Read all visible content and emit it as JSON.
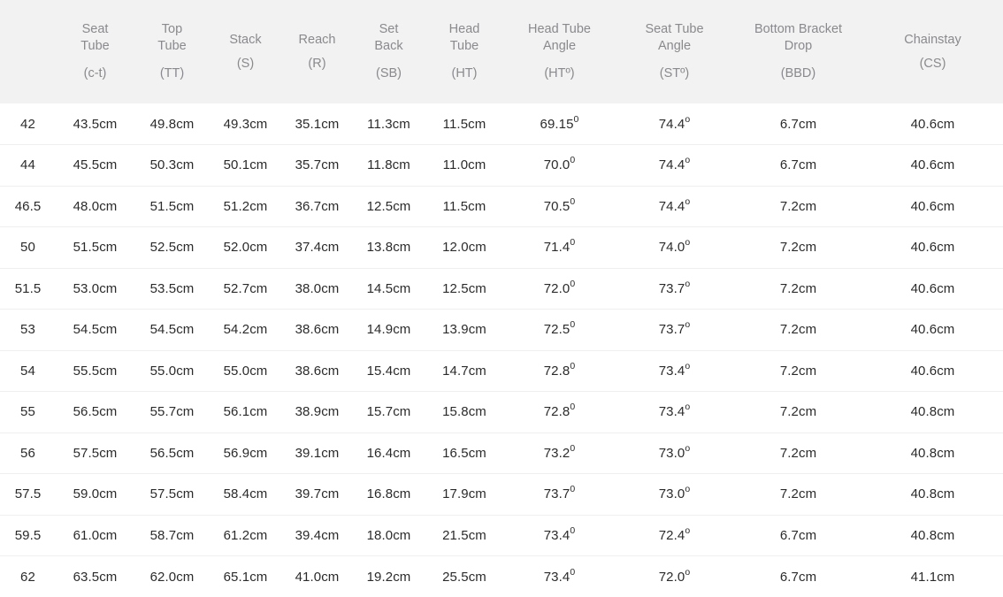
{
  "table": {
    "size_column": {
      "label": "",
      "abbr": ""
    },
    "columns": [
      {
        "name": "seat-tube",
        "label": "Seat\nTube",
        "abbr": "(c-t)",
        "single": false
      },
      {
        "name": "top-tube",
        "label": "Top\nTube",
        "abbr": "(TT)",
        "single": false
      },
      {
        "name": "stack",
        "label": "Stack",
        "abbr": "(S)",
        "single": true
      },
      {
        "name": "reach",
        "label": "Reach",
        "abbr": "(R)",
        "single": true
      },
      {
        "name": "set-back",
        "label": "Set\nBack",
        "abbr": "(SB)",
        "single": false
      },
      {
        "name": "head-tube",
        "label": "Head\nTube",
        "abbr": "(HT)",
        "single": false
      },
      {
        "name": "head-tube-angle",
        "label": "Head Tube\nAngle",
        "abbr": "(HTº)",
        "single": false
      },
      {
        "name": "seat-tube-angle",
        "label": "Seat Tube\nAngle",
        "abbr": "(STº)",
        "single": false
      },
      {
        "name": "bottom-bracket-drop",
        "label": "Bottom Bracket\nDrop",
        "abbr": "(BBD)",
        "single": false
      },
      {
        "name": "chainstay",
        "label": "Chainstay",
        "abbr": "(CS)",
        "single": true
      }
    ],
    "rows": [
      {
        "size": "42",
        "cells": [
          "43.5cm",
          "49.8cm",
          "49.3cm",
          "35.1cm",
          "11.3cm",
          "11.5cm",
          "69.15|0",
          "74.4|o",
          "6.7cm",
          "40.6cm"
        ]
      },
      {
        "size": "44",
        "cells": [
          "45.5cm",
          "50.3cm",
          "50.1cm",
          "35.7cm",
          "11.8cm",
          "11.0cm",
          "70.0|0",
          "74.4|o",
          "6.7cm",
          "40.6cm"
        ]
      },
      {
        "size": "46.5",
        "cells": [
          "48.0cm",
          "51.5cm",
          "51.2cm",
          "36.7cm",
          "12.5cm",
          "11.5cm",
          "70.5|0",
          "74.4|o",
          "7.2cm",
          "40.6cm"
        ]
      },
      {
        "size": "50",
        "cells": [
          "51.5cm",
          "52.5cm",
          "52.0cm",
          "37.4cm",
          "13.8cm",
          "12.0cm",
          "71.4|0",
          "74.0|o",
          "7.2cm",
          "40.6cm"
        ]
      },
      {
        "size": "51.5",
        "cells": [
          "53.0cm",
          "53.5cm",
          "52.7cm",
          "38.0cm",
          "14.5cm",
          "12.5cm",
          "72.0|0",
          "73.7|o",
          "7.2cm",
          "40.6cm"
        ]
      },
      {
        "size": "53",
        "cells": [
          "54.5cm",
          "54.5cm",
          "54.2cm",
          "38.6cm",
          "14.9cm",
          "13.9cm",
          "72.5|0",
          "73.7|o",
          "7.2cm",
          "40.6cm"
        ]
      },
      {
        "size": "54",
        "cells": [
          "55.5cm",
          "55.0cm",
          "55.0cm",
          "38.6cm",
          "15.4cm",
          "14.7cm",
          "72.8|0",
          "73.4|o",
          "7.2cm",
          "40.6cm"
        ]
      },
      {
        "size": "55",
        "cells": [
          "56.5cm",
          "55.7cm",
          "56.1cm",
          "38.9cm",
          "15.7cm",
          "15.8cm",
          "72.8|0",
          "73.4|o",
          "7.2cm",
          "40.8cm"
        ]
      },
      {
        "size": "56",
        "cells": [
          "57.5cm",
          "56.5cm",
          "56.9cm",
          "39.1cm",
          "16.4cm",
          "16.5cm",
          "73.2|0",
          "73.0|o",
          "7.2cm",
          "40.8cm"
        ]
      },
      {
        "size": "57.5",
        "cells": [
          "59.0cm",
          "57.5cm",
          "58.4cm",
          "39.7cm",
          "16.8cm",
          "17.9cm",
          "73.7|0",
          "73.0|o",
          "7.2cm",
          "40.8cm"
        ]
      },
      {
        "size": "59.5",
        "cells": [
          "61.0cm",
          "58.7cm",
          "61.2cm",
          "39.4cm",
          "18.0cm",
          "21.5cm",
          "73.4|0",
          "72.4|o",
          "6.7cm",
          "40.8cm"
        ]
      },
      {
        "size": "62",
        "cells": [
          "63.5cm",
          "62.0cm",
          "65.1cm",
          "41.0cm",
          "19.2cm",
          "25.5cm",
          "73.4|0",
          "72.0|o",
          "6.7cm",
          "41.1cm"
        ]
      }
    ]
  },
  "colors": {
    "header_bg": "#f2f2f2",
    "header_text": "#8a8a8e",
    "size_col_bg": "#f2f2f2",
    "size_col_text": "#a8a8ac",
    "cell_text": "#2b2b2b",
    "row_divider": "#efefef",
    "page_bg": "#ffffff"
  }
}
